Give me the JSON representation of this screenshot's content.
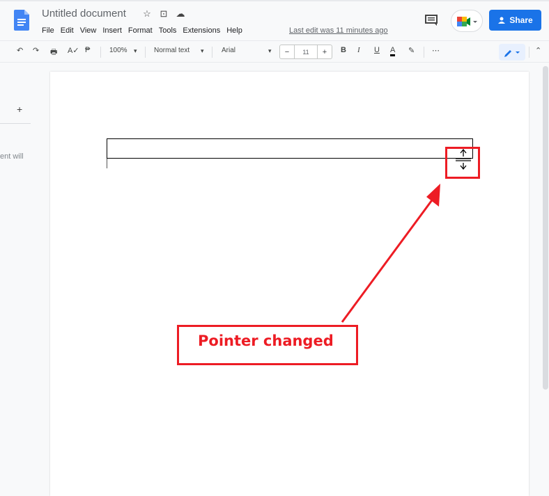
{
  "app": {
    "title": "Untitled document",
    "last_edit": "Last edit was 11 minutes ago",
    "share_label": "Share",
    "brand_color": "#1a73e8",
    "annotation_color": "#ed1c24"
  },
  "title_icons": [
    "star-icon",
    "move-to-folder-icon",
    "cloud-saved-icon"
  ],
  "menu": [
    "File",
    "Edit",
    "View",
    "Insert",
    "Format",
    "Tools",
    "Extensions",
    "Help"
  ],
  "toolbar": {
    "zoom": "100%",
    "style": "Normal text",
    "font": "Arial",
    "font_size": "11",
    "minus": "−",
    "plus": "+",
    "bold": "B",
    "italic": "I",
    "underline": "U",
    "text_color": "A",
    "more": "⋯"
  },
  "left_panel": {
    "add": "+",
    "text": "ent will"
  },
  "annotation": {
    "label": "Pointer changed"
  }
}
